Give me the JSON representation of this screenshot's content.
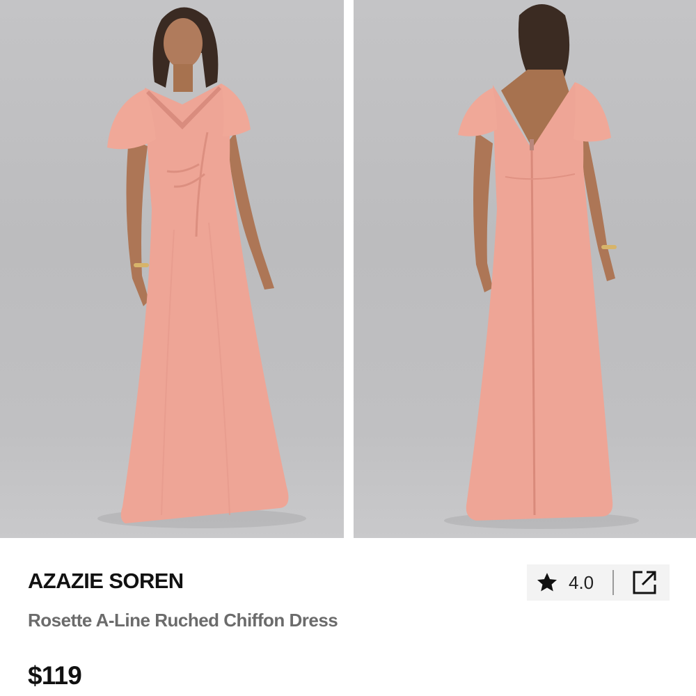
{
  "product": {
    "brand": "AZAZIE SOREN",
    "name": "Rosette A-Line Ruched Chiffon Dress",
    "price": "$119",
    "rating": "4.0",
    "dress_color": "#eea596",
    "background_color": "#c1c1c3"
  },
  "gallery": {
    "images": [
      {
        "view": "front"
      },
      {
        "view": "back"
      }
    ]
  },
  "icons": {
    "rating": "star-icon",
    "share": "external-link-icon"
  }
}
